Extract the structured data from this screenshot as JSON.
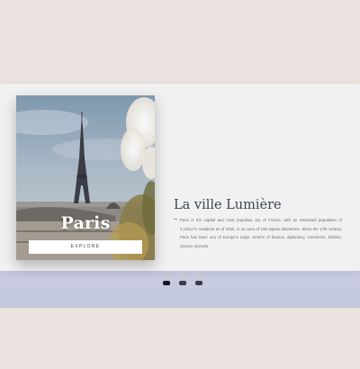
{
  "slide": {
    "city": "Paris",
    "button_label": "EXPLORE",
    "heading": "La ville Lumière",
    "description": "Paris is the capital and most populous city of France, with an estimated population of 2,148,271 residents as of 2020, in an area of 105 square kilometres. Since the 17th century, Paris has been one of Europe's major centres of finance, diplomacy, commerce, fashion, science and arts."
  },
  "pagination": {
    "count": 3,
    "active_index": 0
  },
  "colors": {
    "page_background": "#ece3e1",
    "card_background": "#f1f1f1",
    "band": "#c9cde0",
    "heading": "#3d4550"
  }
}
